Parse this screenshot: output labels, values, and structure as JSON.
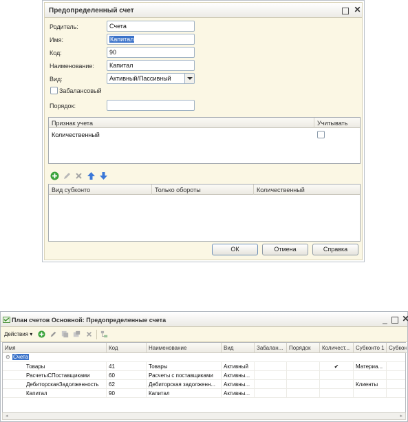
{
  "dialog": {
    "title": "Предопределенный счет",
    "fields": {
      "parent_label": "Родитель:",
      "parent_value": "Счета",
      "name_label": "Имя:",
      "name_value": "Капитал",
      "code_label": "Код:",
      "code_value": "90",
      "title_label": "Наименование:",
      "title_value": "Капитал",
      "kind_label": "Вид:",
      "kind_value": "Активный/Пассивный",
      "offbalance_label": "Забалансовый",
      "order_label": "Порядок:",
      "order_value": ""
    },
    "attr_table": {
      "headers": [
        "Признак учета",
        "Учитывать"
      ],
      "rows": [
        {
          "name": "Количественный"
        }
      ]
    },
    "subconto_table": {
      "headers": [
        "Вид субконто",
        "Только обороты",
        "Количественный"
      ]
    },
    "buttons": {
      "ok": "ОК",
      "cancel": "Отмена",
      "help": "Справка"
    },
    "colors": {
      "add": "#3aa33a",
      "arrows": "#3b78d8"
    }
  },
  "list_window": {
    "title": "План счетов Основной: Предопределенные счета",
    "toolbar": {
      "actions_label": "Действия"
    },
    "columns": [
      "Имя",
      "Код",
      "Наименование",
      "Вид",
      "Забалан...",
      "Порядок",
      "Количест...",
      "Субконто 1",
      "Субкон"
    ],
    "root_label": "Счета",
    "rows": [
      {
        "name": "Товары",
        "code": "41",
        "title": "Товары",
        "kind": "Активный",
        "qty": "✔",
        "sub1": "Материа..."
      },
      {
        "name": "РасчетыСПоставщиками",
        "code": "60",
        "title": "Расчеты с поставщиками",
        "kind": "Активны...",
        "qty": "",
        "sub1": ""
      },
      {
        "name": "ДебиторскаяЗадолженность",
        "code": "62",
        "title": "Дебиторская задолженн...",
        "kind": "Активны...",
        "qty": "",
        "sub1": "Клиенты"
      },
      {
        "name": "Капитал",
        "code": "90",
        "title": "Капитал",
        "kind": "Активны...",
        "qty": "",
        "sub1": ""
      }
    ]
  }
}
